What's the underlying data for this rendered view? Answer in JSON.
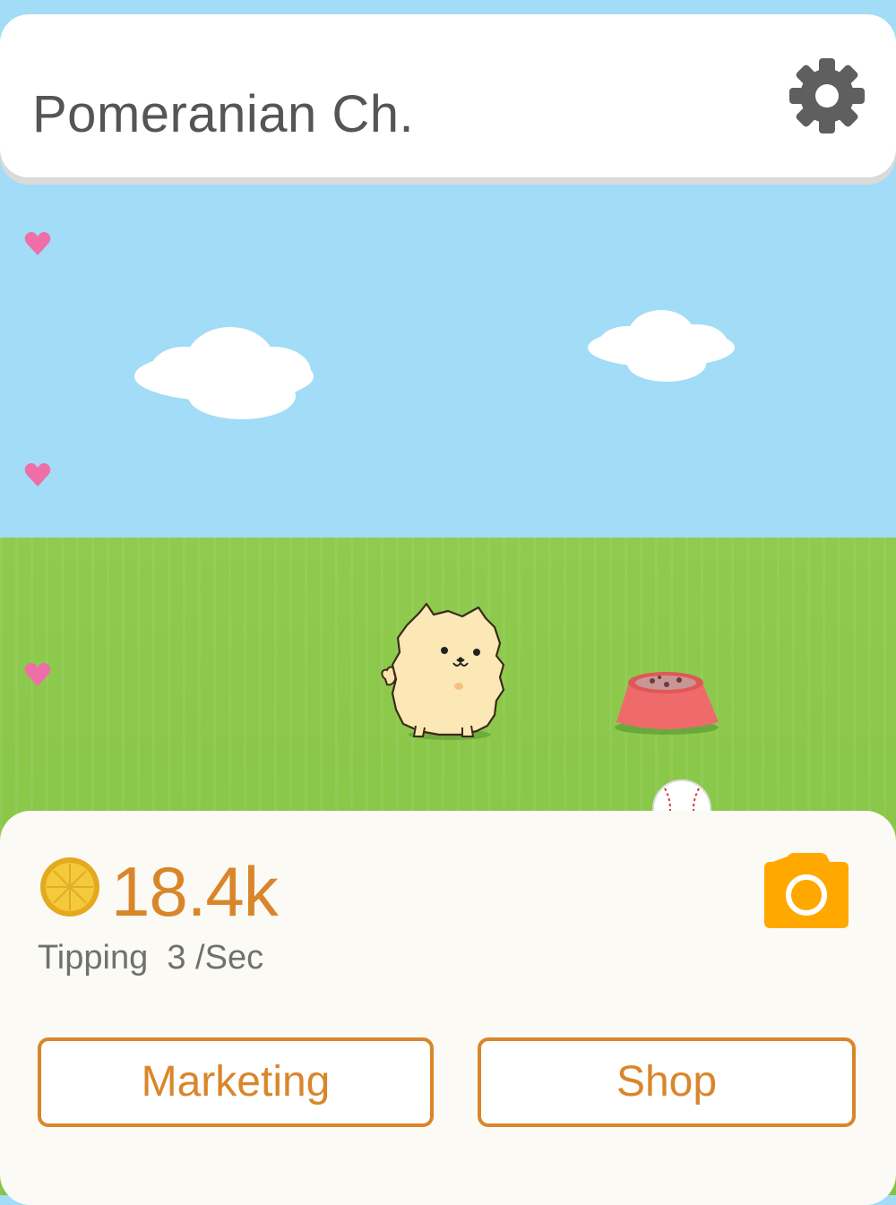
{
  "header": {
    "title": "Pomeranian Ch.",
    "settings_icon": "gear-icon"
  },
  "scene": {
    "pet": "pomeranian-dog",
    "items": [
      "food-bowl",
      "baseball"
    ],
    "hearts": 3
  },
  "stats": {
    "coins": "18.4k",
    "tipping_label": "Tipping",
    "tipping_value": "3 /Sec",
    "coin_icon": "coin-icon",
    "camera_icon": "camera-icon"
  },
  "buttons": {
    "marketing": "Marketing",
    "shop": "Shop"
  },
  "colors": {
    "accent": "#d9862b",
    "camera": "#ffa800",
    "sky": "#a2dcf6",
    "grass": "#86c446",
    "heart": "#ee6fa8"
  }
}
